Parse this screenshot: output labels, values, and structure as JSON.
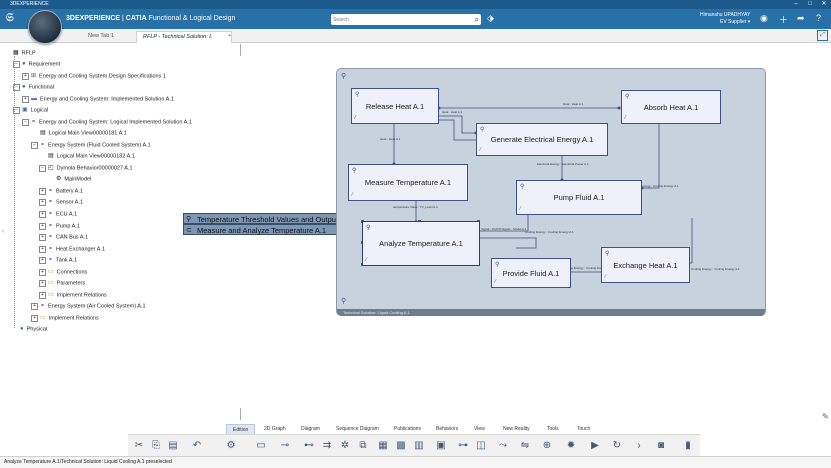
{
  "window": {
    "title": "3DEXPERIENCE"
  },
  "app": {
    "brand": "3DEXPERIENCE",
    "separator": " | ",
    "product": "CATIA",
    "module": "Functional & Logical Design"
  },
  "search": {
    "placeholder": "Search"
  },
  "user": {
    "name": "Himanshu UPADHYAY",
    "role": "EV Supplier ▾"
  },
  "tabs": {
    "tab1": "New Tab 1",
    "tab2": "RFLP - Technical Solution: L",
    "add": "+"
  },
  "tree": {
    "root": "RFLP",
    "requirement": "Requirement",
    "req_item": "Energy and Cooling System Design Specifications 1",
    "functional": "Functional",
    "func_item": "Energy and Cooling System: Implemented Solution A.1",
    "logical": "Logical",
    "log_item": "Energy and Cooling System: Logical Implemented Solution A.1",
    "lmv1": "Logical Main View00000181 A.1",
    "es_fluid": "Energy System (Fluid Cooled System) A.1",
    "lmv2": "Logical Main View00000182 A.1",
    "dymola": "Dymola Behavior00000027 A.1",
    "mainmodel": "MainModel",
    "battery": "Battery A.1",
    "sensor": "Sensor A.1",
    "ecu": "ECU A.1",
    "pump": "Pump A.1",
    "canbus": "CAN Bus A.1",
    "hx": "Heat Exchanger A.1",
    "tank": "Tank A.1",
    "connections": "Connections",
    "parameters": "Parameters",
    "impl_rel": "Implement Relations",
    "es_air": "Energy System (Air Cooled System) A.1",
    "impl_rel2": "Implement Relations",
    "physical": "Physical"
  },
  "preselect": {
    "item1": "Temperature Threshold Values and Outputs A.1",
    "item2": "Measure and Analyze Temperature A.1"
  },
  "diagram": {
    "blocks": {
      "release_heat": "Release Heat A.1",
      "absorb_heat": "Absorb Heat A.1",
      "gen_energy": "Generate Electrical Energy A.1",
      "measure_temp": "Measure Temperature A.1",
      "pump_fluid": "Pump Fluid A.1",
      "analyze_temp": "Analyze Temperature A.1",
      "provide_fluid": "Provide Fluid A.1",
      "exchange_heat": "Exchange Heat A.1"
    },
    "flows": {
      "heat1": "Heat : Heat A.1",
      "heat2": "Heat : Heat A.1",
      "heat3": "Heat : Heat A.1",
      "elec": "Electrical Energy : Electrical Power A.1",
      "temp": "temperature Value : TV_Level A.1",
      "cool1": "Cooling Energy : Cooling Energy A.1",
      "cool2": "Cooling Energy : Cooling Energy A.1",
      "cool3": "Cooling Energy : Cooling Energy A.1",
      "cool4": "Cooling Energy : Cooling Energy A.1",
      "signal": "Signal : On/Off Signal... Model A.1"
    },
    "footer": "Technical Solution: Liquid Cooling A.1"
  },
  "bottom_tabs": [
    "Edition",
    "2D Graph",
    "Diagram",
    "Sequence Diagram",
    "Publications",
    "Behaviors",
    "View",
    "New Reality",
    "Tools",
    "Touch"
  ],
  "status": "Analyze Temperature A.1/Technical Solution: Liquid Cooling A.1 preselected",
  "colors": {
    "header": "#2770a8",
    "block_border": "#3d4f8c",
    "diagram_bg": "#c7d2dc",
    "preselect": "#7e96b4"
  }
}
